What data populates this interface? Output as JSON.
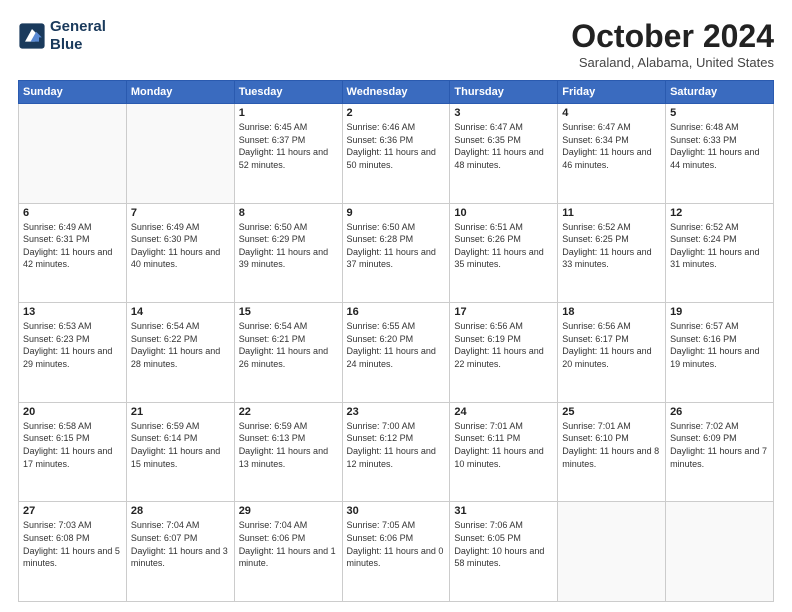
{
  "header": {
    "logo_line1": "General",
    "logo_line2": "Blue",
    "month_title": "October 2024",
    "location": "Saraland, Alabama, United States"
  },
  "days_of_week": [
    "Sunday",
    "Monday",
    "Tuesday",
    "Wednesday",
    "Thursday",
    "Friday",
    "Saturday"
  ],
  "weeks": [
    [
      {
        "day": "",
        "info": ""
      },
      {
        "day": "",
        "info": ""
      },
      {
        "day": "1",
        "info": "Sunrise: 6:45 AM\nSunset: 6:37 PM\nDaylight: 11 hours and 52 minutes."
      },
      {
        "day": "2",
        "info": "Sunrise: 6:46 AM\nSunset: 6:36 PM\nDaylight: 11 hours and 50 minutes."
      },
      {
        "day": "3",
        "info": "Sunrise: 6:47 AM\nSunset: 6:35 PM\nDaylight: 11 hours and 48 minutes."
      },
      {
        "day": "4",
        "info": "Sunrise: 6:47 AM\nSunset: 6:34 PM\nDaylight: 11 hours and 46 minutes."
      },
      {
        "day": "5",
        "info": "Sunrise: 6:48 AM\nSunset: 6:33 PM\nDaylight: 11 hours and 44 minutes."
      }
    ],
    [
      {
        "day": "6",
        "info": "Sunrise: 6:49 AM\nSunset: 6:31 PM\nDaylight: 11 hours and 42 minutes."
      },
      {
        "day": "7",
        "info": "Sunrise: 6:49 AM\nSunset: 6:30 PM\nDaylight: 11 hours and 40 minutes."
      },
      {
        "day": "8",
        "info": "Sunrise: 6:50 AM\nSunset: 6:29 PM\nDaylight: 11 hours and 39 minutes."
      },
      {
        "day": "9",
        "info": "Sunrise: 6:50 AM\nSunset: 6:28 PM\nDaylight: 11 hours and 37 minutes."
      },
      {
        "day": "10",
        "info": "Sunrise: 6:51 AM\nSunset: 6:26 PM\nDaylight: 11 hours and 35 minutes."
      },
      {
        "day": "11",
        "info": "Sunrise: 6:52 AM\nSunset: 6:25 PM\nDaylight: 11 hours and 33 minutes."
      },
      {
        "day": "12",
        "info": "Sunrise: 6:52 AM\nSunset: 6:24 PM\nDaylight: 11 hours and 31 minutes."
      }
    ],
    [
      {
        "day": "13",
        "info": "Sunrise: 6:53 AM\nSunset: 6:23 PM\nDaylight: 11 hours and 29 minutes."
      },
      {
        "day": "14",
        "info": "Sunrise: 6:54 AM\nSunset: 6:22 PM\nDaylight: 11 hours and 28 minutes."
      },
      {
        "day": "15",
        "info": "Sunrise: 6:54 AM\nSunset: 6:21 PM\nDaylight: 11 hours and 26 minutes."
      },
      {
        "day": "16",
        "info": "Sunrise: 6:55 AM\nSunset: 6:20 PM\nDaylight: 11 hours and 24 minutes."
      },
      {
        "day": "17",
        "info": "Sunrise: 6:56 AM\nSunset: 6:19 PM\nDaylight: 11 hours and 22 minutes."
      },
      {
        "day": "18",
        "info": "Sunrise: 6:56 AM\nSunset: 6:17 PM\nDaylight: 11 hours and 20 minutes."
      },
      {
        "day": "19",
        "info": "Sunrise: 6:57 AM\nSunset: 6:16 PM\nDaylight: 11 hours and 19 minutes."
      }
    ],
    [
      {
        "day": "20",
        "info": "Sunrise: 6:58 AM\nSunset: 6:15 PM\nDaylight: 11 hours and 17 minutes."
      },
      {
        "day": "21",
        "info": "Sunrise: 6:59 AM\nSunset: 6:14 PM\nDaylight: 11 hours and 15 minutes."
      },
      {
        "day": "22",
        "info": "Sunrise: 6:59 AM\nSunset: 6:13 PM\nDaylight: 11 hours and 13 minutes."
      },
      {
        "day": "23",
        "info": "Sunrise: 7:00 AM\nSunset: 6:12 PM\nDaylight: 11 hours and 12 minutes."
      },
      {
        "day": "24",
        "info": "Sunrise: 7:01 AM\nSunset: 6:11 PM\nDaylight: 11 hours and 10 minutes."
      },
      {
        "day": "25",
        "info": "Sunrise: 7:01 AM\nSunset: 6:10 PM\nDaylight: 11 hours and 8 minutes."
      },
      {
        "day": "26",
        "info": "Sunrise: 7:02 AM\nSunset: 6:09 PM\nDaylight: 11 hours and 7 minutes."
      }
    ],
    [
      {
        "day": "27",
        "info": "Sunrise: 7:03 AM\nSunset: 6:08 PM\nDaylight: 11 hours and 5 minutes."
      },
      {
        "day": "28",
        "info": "Sunrise: 7:04 AM\nSunset: 6:07 PM\nDaylight: 11 hours and 3 minutes."
      },
      {
        "day": "29",
        "info": "Sunrise: 7:04 AM\nSunset: 6:06 PM\nDaylight: 11 hours and 1 minute."
      },
      {
        "day": "30",
        "info": "Sunrise: 7:05 AM\nSunset: 6:06 PM\nDaylight: 11 hours and 0 minutes."
      },
      {
        "day": "31",
        "info": "Sunrise: 7:06 AM\nSunset: 6:05 PM\nDaylight: 10 hours and 58 minutes."
      },
      {
        "day": "",
        "info": ""
      },
      {
        "day": "",
        "info": ""
      }
    ]
  ]
}
